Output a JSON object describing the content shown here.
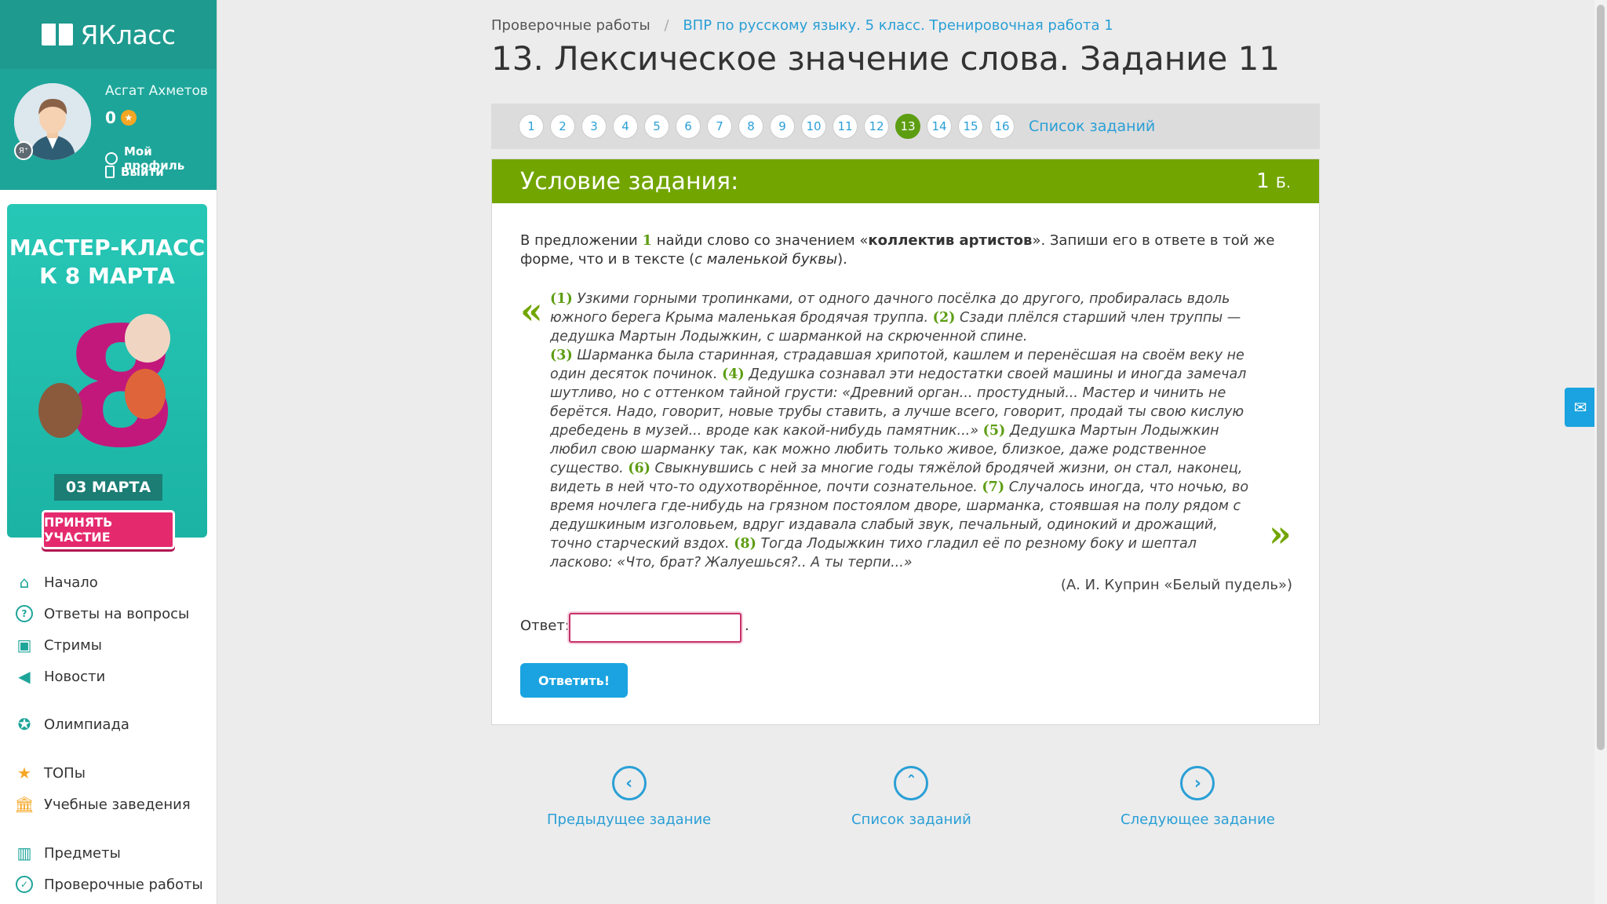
{
  "brand": {
    "logo_text": "ЯКласс"
  },
  "profile": {
    "name": "Асгат Ахметов",
    "score": "0",
    "badge_text": "Я⁺",
    "my_profile": "Мой профиль",
    "logout": "Выйти"
  },
  "banner": {
    "title_line1": "МАСТЕР-КЛАСС",
    "title_line2": "К 8 МАРТА",
    "big_number": "8",
    "date": "03 МАРТА",
    "cta": "ПРИНЯТЬ УЧАСТИЕ"
  },
  "nav": {
    "items": [
      {
        "label": "Начало",
        "icon": "home-icon"
      },
      {
        "label": "Ответы на вопросы",
        "icon": "question-icon"
      },
      {
        "label": "Стримы",
        "icon": "play-icon"
      },
      {
        "label": "Новости",
        "icon": "megaphone-icon"
      },
      {
        "label": "Олимпиада",
        "icon": "medal-icon"
      },
      {
        "label": "ТОПы",
        "icon": "star-icon"
      },
      {
        "label": "Учебные заведения",
        "icon": "building-icon"
      },
      {
        "label": "Предметы",
        "icon": "books-icon"
      },
      {
        "label": "Проверочные работы",
        "icon": "check-icon"
      }
    ]
  },
  "breadcrumbs": {
    "root": "Проверочные работы",
    "separator": "/",
    "current": "ВПР по русскому языку. 5 класс. Тренировочная работа 1"
  },
  "page_title": "13. Лексическое значение слова. Задание 11",
  "pager": {
    "pages": [
      "1",
      "2",
      "3",
      "4",
      "5",
      "6",
      "7",
      "8",
      "9",
      "10",
      "11",
      "12",
      "13",
      "14",
      "15",
      "16"
    ],
    "active": "13",
    "list_link": "Список заданий"
  },
  "task": {
    "header": "Условие задания:",
    "points_value": "1",
    "points_unit": "Б.",
    "question": {
      "part1": "В предложении ",
      "sentence_num": "1",
      "part2": " найди слово со значением «",
      "keyword": "коллектив артистов",
      "part3": "». Запиши его в ответе в той же форме, что и в тексте (",
      "hint": "с маленькой буквы",
      "part4": ")."
    },
    "quote_open": "«",
    "quote_close": "»",
    "passage": [
      {
        "n": "1",
        "text": " Узкими горными тропинками, от одного дачного посёлка до другого, пробиралась вдоль южного берега Крыма маленькая бродячая труппа. "
      },
      {
        "n": "2",
        "text": " Сзади плёлся старший член труппы — дедушка Мартын Лодыжкин, с шарманкой на скрюченной спине."
      },
      {
        "n": "3",
        "text": " Шарманка была старинная, страдавшая хрипотой, кашлем и перенёсшая на своём веку не один десяток починок. "
      },
      {
        "n": "4",
        "text": " Дедушка сознавал эти недостатки своей машины и иногда замечал шутливо, но с оттенком тайной грусти: «Древний орган... простудный... Мастер и чинить не берётся. Надо, говорит, новые трубы ставить, а лучше всего, говорит, продай ты свою кислую дребедень в музей... вроде как какой-нибудь памятник...» "
      },
      {
        "n": "5",
        "text": " Дедушка Мартын Лодыжкин любил свою шарманку так, как можно любить только живое, близкое, даже родственное существо. "
      },
      {
        "n": "6",
        "text": " Свыкнувшись с ней за многие годы тяжёлой бродячей жизни, он стал, наконец, видеть в ней что-то одухотворённое, почти сознательное. "
      },
      {
        "n": "7",
        "text": " Случалось иногда, что ночью, во время ночлега где-нибудь на грязном постоялом дворе, шарманка, стоявшая на полу рядом с дедушкиным изголовьем, вдруг издавала слабый звук, печальный, одинокий и дрожащий, точно старческий вздох. "
      },
      {
        "n": "8",
        "text": " Тогда Лодыжкин тихо гладил её по резному боку и шептал ласково: «Что, брат? Жалуешься?.. А ты терпи...»"
      }
    ],
    "author": "(А. И. Куприн «Белый пудель»)",
    "answer_label": "Ответ:",
    "answer_value": "",
    "answer_suffix": ".",
    "submit": "Ответить!"
  },
  "bottom_nav": {
    "prev": "Предыдущее задание",
    "list": "Список заданий",
    "next": "Следующее задание"
  },
  "colors": {
    "brand_teal": "#1e9a8f",
    "header_green": "#72a500",
    "link_blue": "#2a9fd6",
    "button_blue": "#1aa3e0",
    "cta_pink": "#e42a6d"
  }
}
